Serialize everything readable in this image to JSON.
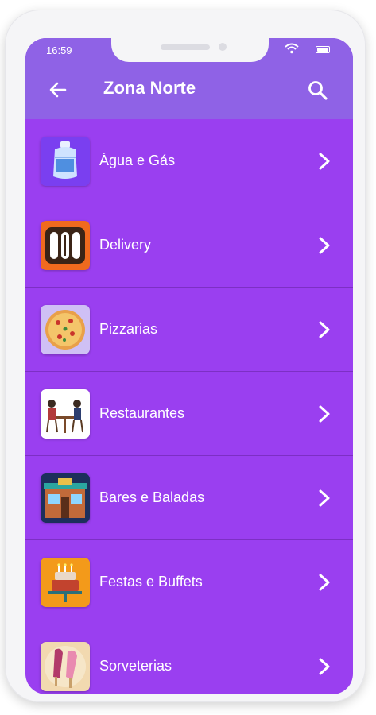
{
  "status_bar": {
    "time": "16:59"
  },
  "header": {
    "title": "Zona Norte"
  },
  "categories": [
    {
      "label": "Água e Gás",
      "icon": "water-gallon-icon",
      "color": "#7a3ff0"
    },
    {
      "label": "Delivery",
      "icon": "delivery-food-icon",
      "color": "#f06a1e"
    },
    {
      "label": "Pizzarias",
      "icon": "pizza-icon",
      "color": "#cfc0f5"
    },
    {
      "label": "Restaurantes",
      "icon": "restaurant-icon",
      "color": "#ffffff"
    },
    {
      "label": "Bares e Baladas",
      "icon": "bar-icon",
      "color": "#1d2f5c"
    },
    {
      "label": "Festas e Buffets",
      "icon": "cake-icon",
      "color": "#f39a1a"
    },
    {
      "label": "Sorveterias",
      "icon": "ice-cream-icon",
      "color": "#f2d9b0"
    }
  ],
  "colors": {
    "header": "#8f62e6",
    "list": "#9a3ff0",
    "divider": "#7d2fc4"
  }
}
